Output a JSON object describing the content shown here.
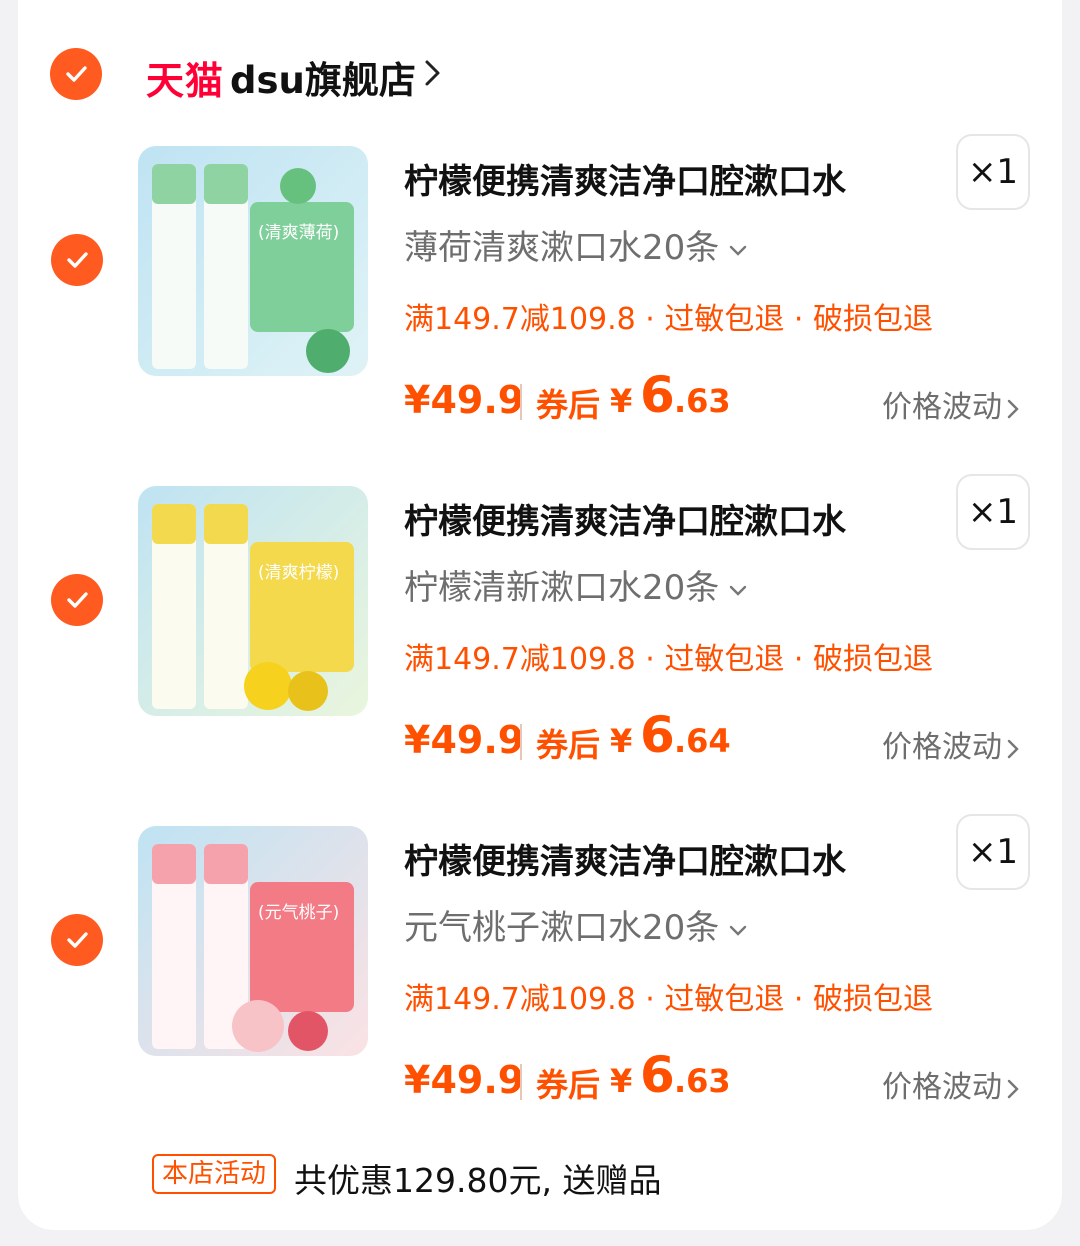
{
  "store": {
    "logo": "天猫",
    "name": "dsu旗舰店"
  },
  "items": [
    {
      "title": "柠檬便携清爽洁净口腔漱口水",
      "variant": "薄荷清爽漱口水20条",
      "promo": "满149.7减109.8 · 过敏包退 · 破损包退",
      "price": "¥49.9",
      "after_label": "券后",
      "after_yen": "¥",
      "after_int": "6",
      "after_dec": ".63",
      "price_trend": "价格波动",
      "qty": "×1",
      "theme": {
        "bg1": "#bfe3f3",
        "bg2": "#dff3f6",
        "card": "#7fcf9a",
        "tag": "(清爽薄荷)",
        "accent": "#4fae6d"
      }
    },
    {
      "title": "柠檬便携清爽洁净口腔漱口水",
      "variant": "柠檬清新漱口水20条",
      "promo": "满149.7减109.8 · 过敏包退 · 破损包退",
      "price": "¥49.9",
      "after_label": "券后",
      "after_yen": "¥",
      "after_int": "6",
      "after_dec": ".64",
      "price_trend": "价格波动",
      "qty": "×1",
      "theme": {
        "bg1": "#bfe3f3",
        "bg2": "#eaf6dd",
        "card": "#f5d94c",
        "tag": "(清爽柠檬)",
        "accent": "#e8c21a"
      }
    },
    {
      "title": "柠檬便携清爽洁净口腔漱口水",
      "variant": "元气桃子漱口水20条",
      "promo": "满149.7减109.8 · 过敏包退 · 破损包退",
      "price": "¥49.9",
      "after_label": "券后",
      "after_yen": "¥",
      "after_int": "6",
      "after_dec": ".63",
      "price_trend": "价格波动",
      "qty": "×1",
      "theme": {
        "bg1": "#bfe3f3",
        "bg2": "#fbe2e4",
        "card": "#f27b86",
        "tag": "(元气桃子)",
        "accent": "#e25566"
      }
    }
  ],
  "activity": {
    "badge": "本店活动",
    "text": "共优惠129.80元, 送赠品"
  }
}
